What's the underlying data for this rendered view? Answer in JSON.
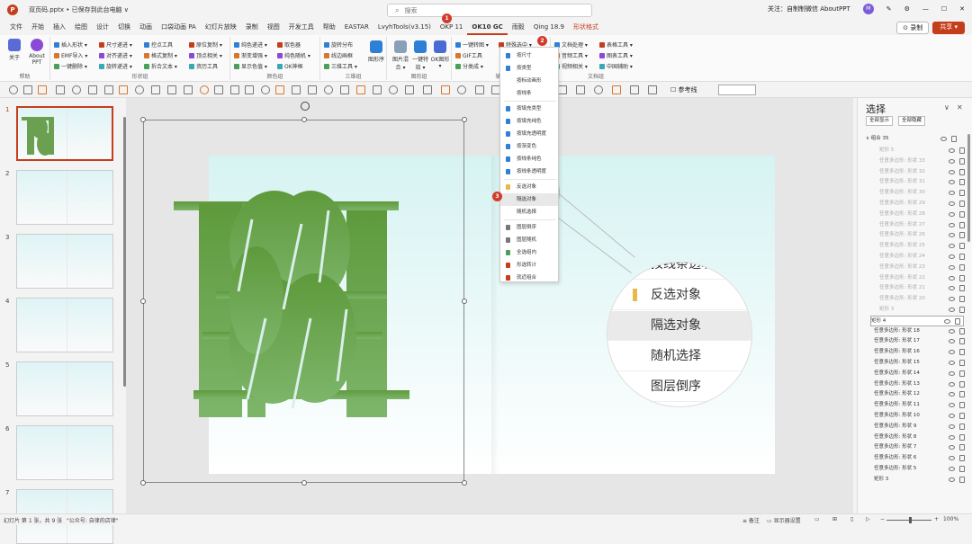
{
  "titlebar": {
    "app_logo": "P",
    "doc_title": "双页码.pptx • 已保存到此台电脑 ∨",
    "search_placeholder": "搜索",
    "follow_text": "关注：自制制微信 AboutPPT",
    "avatar_text": "M",
    "minimize": "—",
    "maximize": "☐",
    "close": "✕"
  },
  "menu": {
    "tabs": [
      "文件",
      "开始",
      "插入",
      "绘图",
      "设计",
      "切换",
      "动画",
      "口袋动画 PA",
      "幻灯片放映",
      "录制",
      "视图",
      "开发工具",
      "帮助",
      "EASTAR",
      "LvyhTools(v3.15)",
      "OKP 11",
      "OK10 GC",
      "雨毅",
      "Qing 18.9",
      "形状格式"
    ],
    "active_index": 16,
    "record_label": "⊙ 录制",
    "share_label": "共享 ▾"
  },
  "ribbon": {
    "group1": {
      "about_label": "关于",
      "about2_label": "About PPT",
      "name": "帮助"
    },
    "group2": {
      "items": [
        "插入形状 ▾",
        "EMF导入 ▾",
        "一键删除 ▾",
        "尺寸递进 ▾",
        "对齐递进 ▾",
        "旋转递进 ▾",
        "控点工具",
        "格式复制 ▾",
        "拆合文本 ▾",
        "原位复制 ▾",
        "顶点相关 ▾",
        "资历工具"
      ],
      "name": "形状组"
    },
    "group3": {
      "items": [
        "纯色递进 ▾",
        "渐变增强 ▾",
        "显示色值 ▾",
        "取色器",
        "纯色随机 ▾",
        "OK神框"
      ],
      "name": "颜色组"
    },
    "group4": {
      "items": [
        "旋转分布",
        "线边画框",
        "三维工具 ▾"
      ],
      "big_label": "图形序",
      "name": "三维组"
    },
    "group5": {
      "items": [
        "图片混合 ▾",
        "一键特效 ▾",
        "OK图形 ▾"
      ],
      "name": "图形组"
    },
    "group6": {
      "items": [
        "一键转图 ▾",
        "GIF工具",
        "分类成 ▾",
        "特殊选中 ▾"
      ],
      "name": "辅助"
    },
    "group7": {
      "items": [
        "文档处理 ▾",
        "音频工具 ▾",
        "视频相关 ▾",
        "表格工具 ▾",
        "图表工具 ▾",
        "中国辅助 ▾"
      ],
      "name": "文档组"
    }
  },
  "quickbar": {
    "ref_label": "参考线"
  },
  "thumbs": {
    "numbers": [
      "1",
      "2",
      "3",
      "4",
      "5",
      "6",
      "7"
    ]
  },
  "dropdown": {
    "items": [
      "按尺寸",
      "按类型",
      "按标动画形",
      "按线条",
      "按填充类型",
      "按填充纯色",
      "按填充透明度",
      "按渐变色",
      "按线条纯色",
      "按线条透明度",
      "反选对象",
      "隔选对象",
      "随机选择",
      "图层倒序",
      "图层随机",
      "全选组内",
      "形选转计",
      "就近组合"
    ]
  },
  "zoom_circle": {
    "items": [
      "按线条透明度",
      "反选对象",
      "隔选对象",
      "随机选择",
      "图层倒序"
    ]
  },
  "badges": {
    "b1": "1",
    "b2": "2",
    "b3": "3"
  },
  "selection_pane": {
    "title": "选择",
    "show_all": "全部显示",
    "hide_all": "全部隐藏",
    "group_label": "∨ 组合 35",
    "dim_rows": [
      "矩形 5",
      "任意多边形: 形状 33",
      "任意多边形: 形状 32",
      "任意多边形: 形状 31",
      "任意多边形: 形状 30",
      "任意多边形: 形状 29",
      "任意多边形: 形状 28",
      "任意多边形: 形状 27",
      "任意多边形: 形状 26",
      "任意多边形: 形状 25",
      "任意多边形: 形状 24",
      "任意多边形: 形状 23",
      "任意多边形: 形状 22",
      "任意多边形: 形状 21",
      "任意多边形: 形状 20",
      "矩形 3"
    ],
    "boxed_row": "矩形 4",
    "normal_rows": [
      "任意多边形: 形状 18",
      "任意多边形: 形状 17",
      "任意多边形: 形状 16",
      "任意多边形: 形状 15",
      "任意多边形: 形状 14",
      "任意多边形: 形状 13",
      "任意多边形: 形状 12",
      "任意多边形: 形状 11",
      "任意多边形: 形状 10",
      "任意多边形: 形状 9",
      "任意多边形: 形状 8",
      "任意多边形: 形状 7",
      "任意多边形: 形状 6",
      "任意多边形: 形状 5",
      "矩形 3"
    ]
  },
  "status": {
    "slide_info": "幻灯片 第 1 张，共 9 张",
    "note": "\"公众号: 自律的店律\"",
    "comments": "≡ 备注",
    "display": "▭ 显示器设置",
    "zoom": "100%"
  },
  "colors": {
    "accent": "#c43e1c",
    "green_shape": "#6aa04f",
    "badge": "#d23b2b"
  }
}
